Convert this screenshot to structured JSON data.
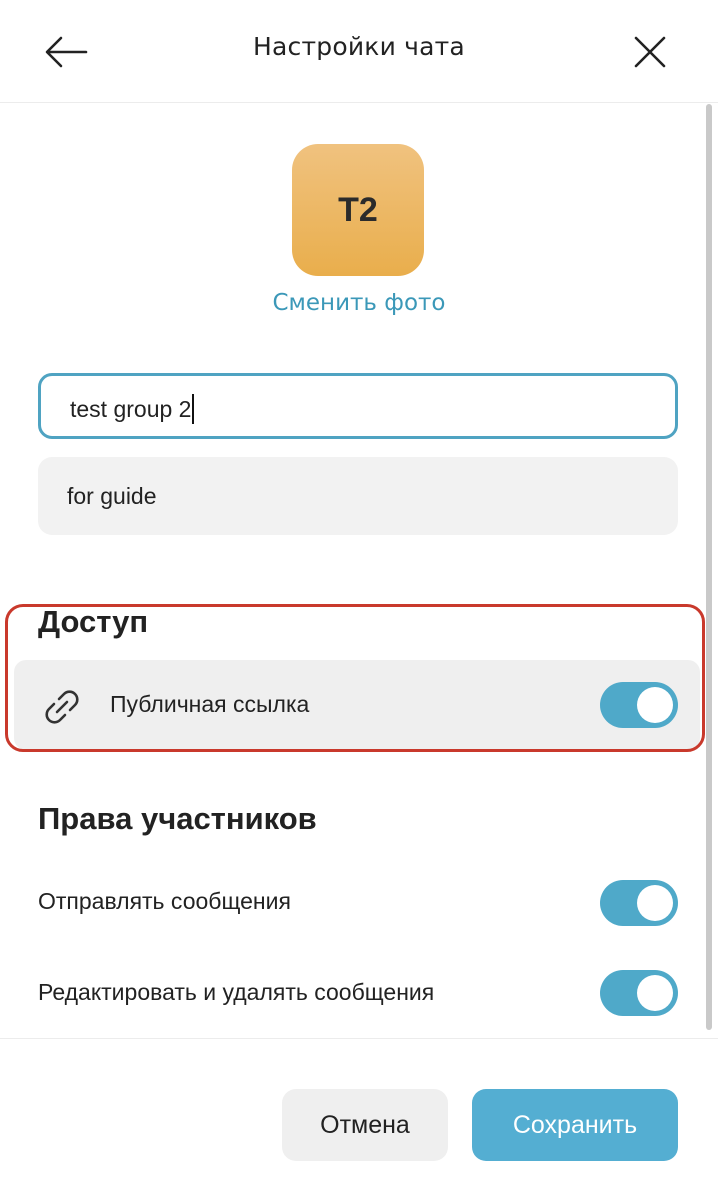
{
  "header": {
    "title": "Настройки чата",
    "back_icon": "arrow-left-icon",
    "close_icon": "close-icon"
  },
  "avatar": {
    "initials": "T2",
    "color": "#ecb65e",
    "change_photo_label": "Сменить фото"
  },
  "form": {
    "name_value": "test group 2",
    "description_value": "for guide"
  },
  "access": {
    "title": "Доступ",
    "public_link_label": "Публичная ссылка",
    "public_link_icon": "link-icon",
    "public_link_enabled": true
  },
  "rights": {
    "title": "Права участников",
    "items": [
      {
        "label": "Отправлять сообщения",
        "enabled": true
      },
      {
        "label": "Редактировать и удалять сообщения",
        "enabled": true
      }
    ]
  },
  "footer": {
    "cancel_label": "Отмена",
    "save_label": "Сохранить"
  },
  "colors": {
    "accent": "#4fa9c9",
    "highlight": "#c9392c",
    "link": "#3b98b8"
  }
}
